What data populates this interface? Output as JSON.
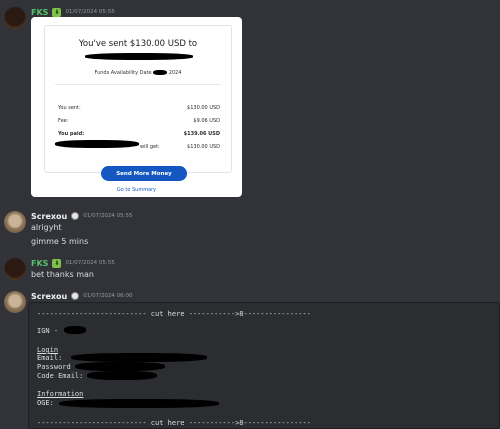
{
  "messages": [
    {
      "author": "FKS",
      "time": "01/07/2024 05:55"
    },
    {
      "author": "Screxou",
      "time": "01/07/2024 05:55",
      "lines": [
        "alrigyht",
        "gimme 5 mins"
      ]
    },
    {
      "author": "FKS",
      "time": "01/07/2024 05:55",
      "lines": [
        "bet thanks man"
      ]
    },
    {
      "author": "Screxou",
      "time": "01/07/2024 06:00"
    }
  ],
  "badge_fks": "⬇",
  "receipt": {
    "title": "You've sent $130.00 USD to",
    "availability_prefix": "Funds Availability Date",
    "availability_year": "2024",
    "rows": [
      {
        "label": "You sent:",
        "value": "$130.00 USD"
      },
      {
        "label": "Fee:",
        "value": "$9.06 USD"
      },
      {
        "label": "You paid:",
        "value": "$139.06 USD"
      },
      {
        "label": "will get:",
        "value": "$130.00 USD"
      }
    ],
    "button_label": "Send More Money",
    "summary_link": "Go to Summary"
  },
  "code_block": {
    "cut_line": "-------------------------- cut here ----------->8----------------",
    "ign_label": "IGN -",
    "login_heading": "Login",
    "email_label": "Email:",
    "password_label": "Password",
    "code_email_label": "Code Email:",
    "info_heading": "Information",
    "oge_label": "OGE:"
  },
  "colors": {
    "background": "#313338",
    "username_green": "#56c26c",
    "paypal_blue": "#1457c1"
  }
}
